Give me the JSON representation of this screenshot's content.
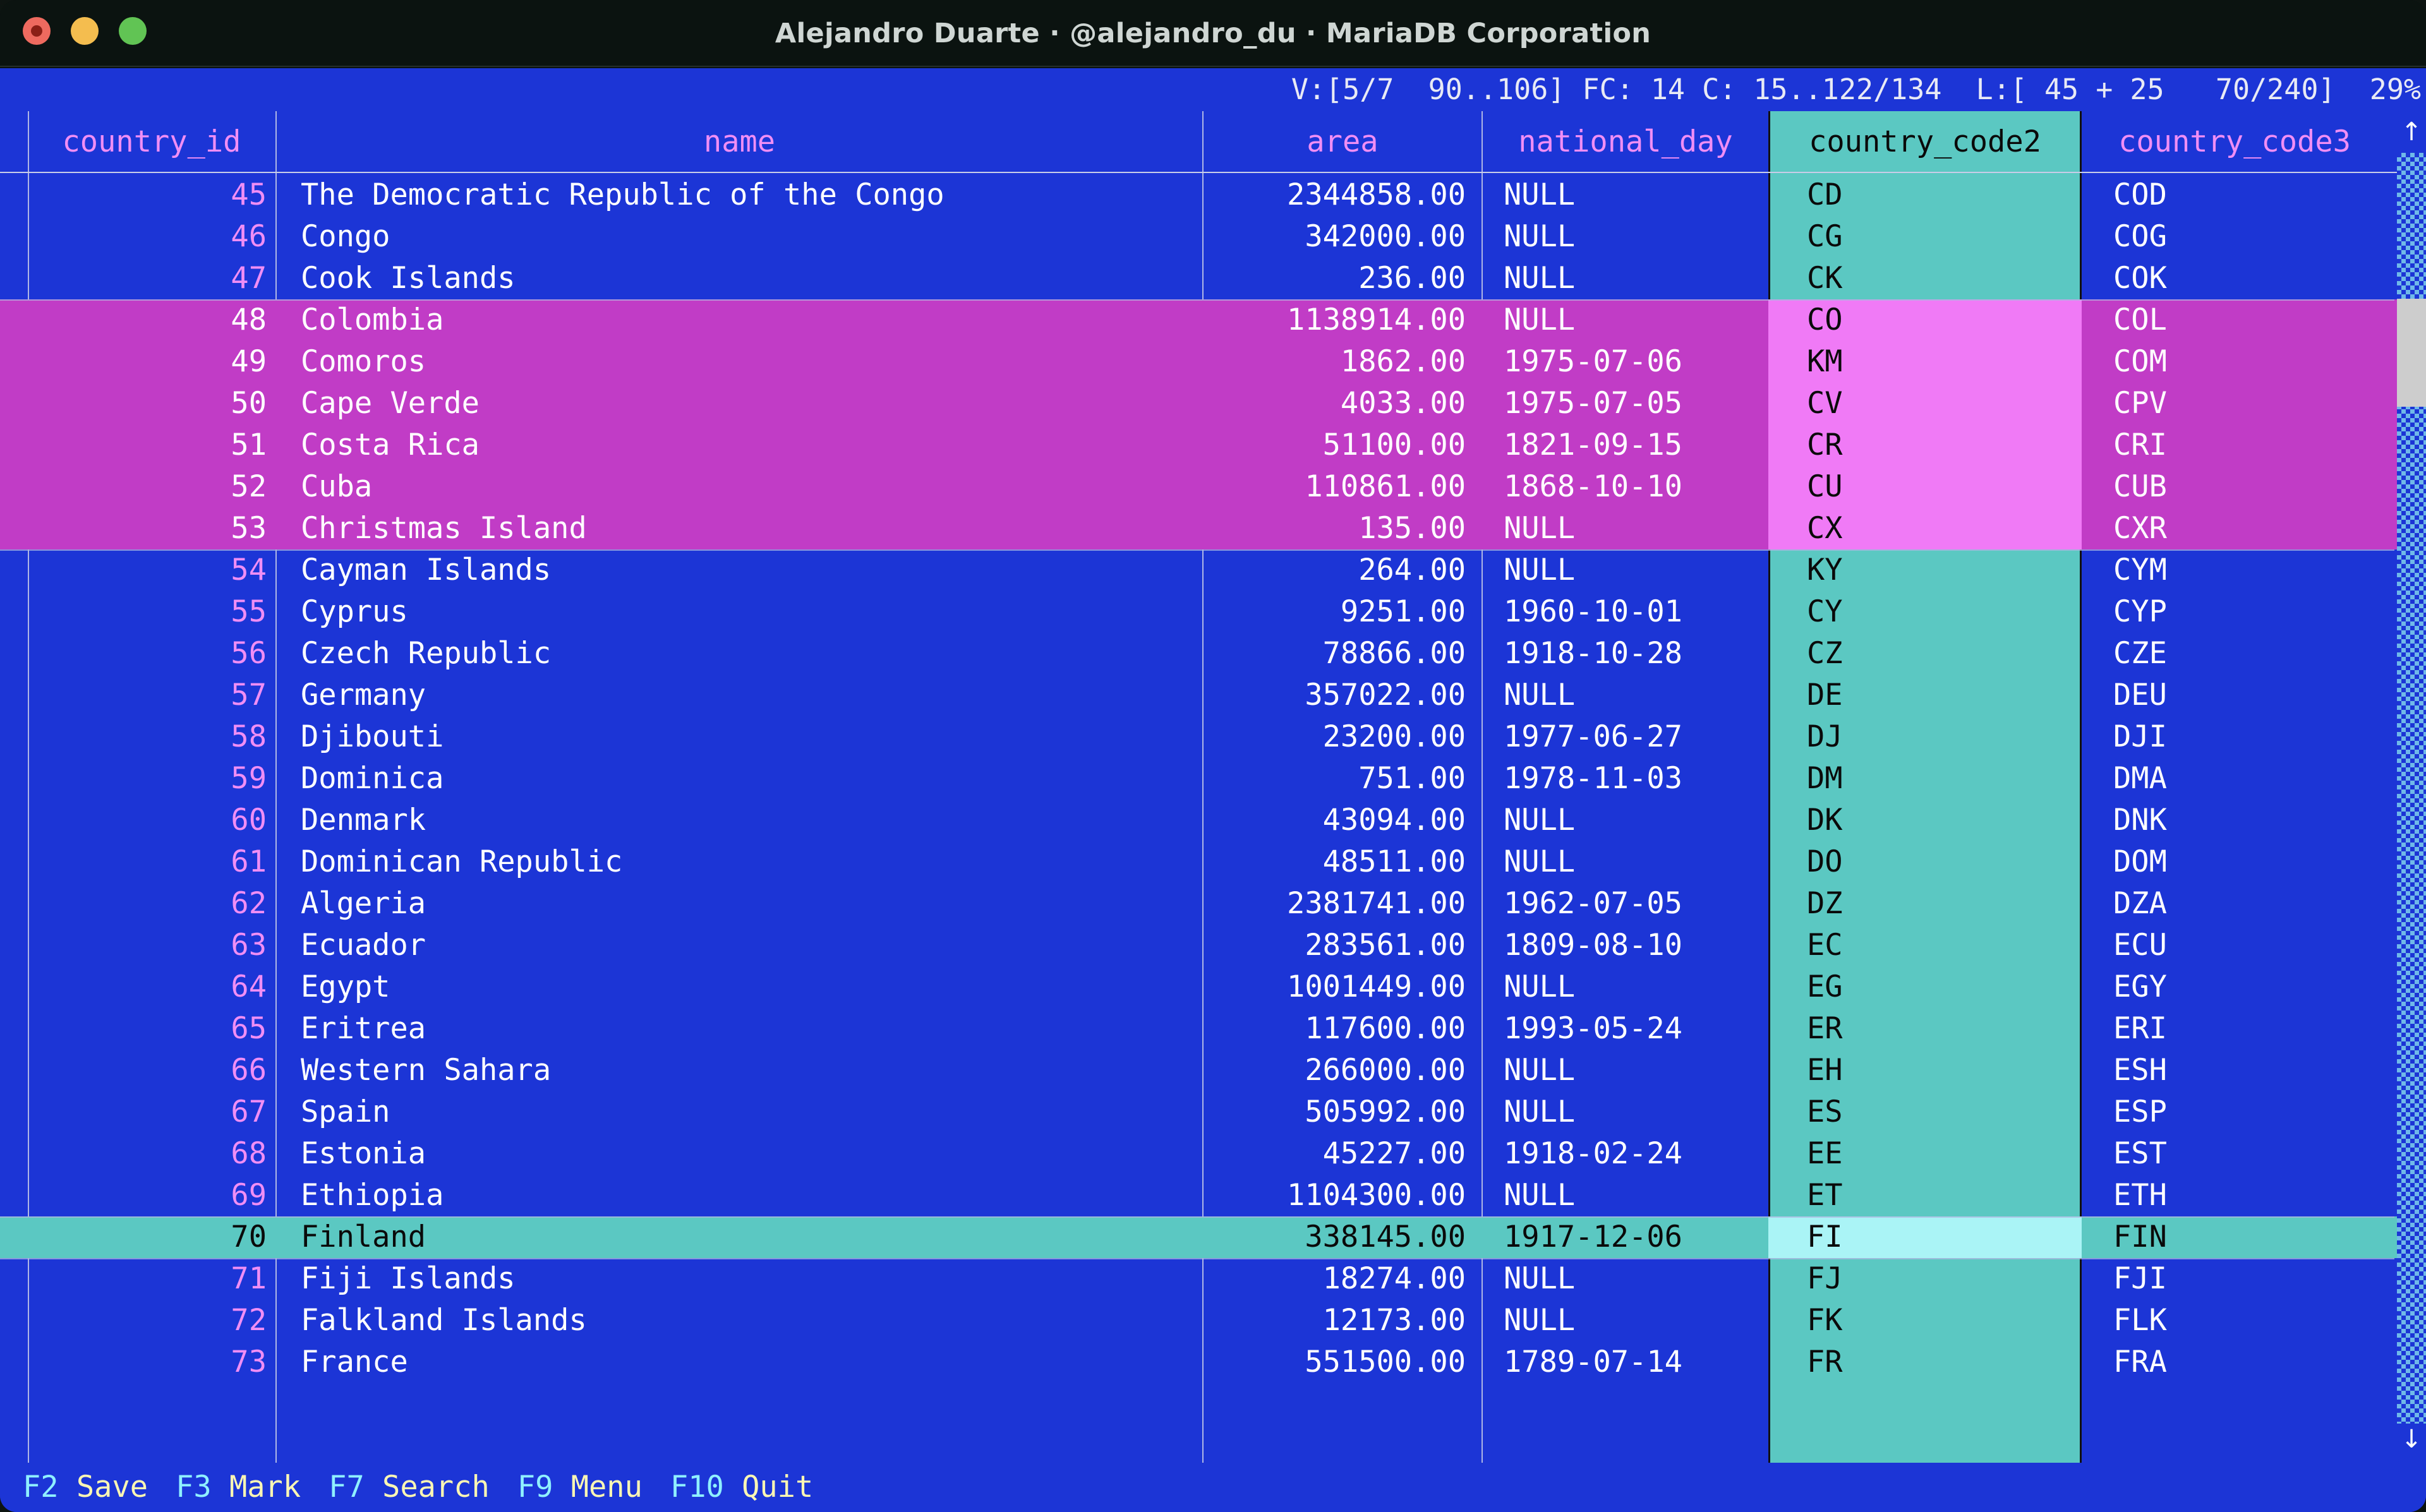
{
  "window": {
    "title": "Alejandro Duarte · @alejandro_du · MariaDB Corporation",
    "traffic_lights": [
      "close",
      "minimize",
      "zoom"
    ]
  },
  "statusline": {
    "text": "V:[5/7  90..106] FC: 14 C: 15..122/134  L:[ 45 + 25   70/240]  29%",
    "view": "V:[5/7  90..106]",
    "field_count": "FC: 14",
    "columns": "C: 15..122/134",
    "lines": "L:[ 45 + 25   70/240]",
    "percent": "29%"
  },
  "table": {
    "columns": [
      {
        "key": "country_id",
        "label": "country_id",
        "align": "right",
        "highlighted": false
      },
      {
        "key": "name",
        "label": "name",
        "align": "left",
        "highlighted": false
      },
      {
        "key": "area",
        "label": "area",
        "align": "right",
        "highlighted": false
      },
      {
        "key": "national_day",
        "label": "national_day",
        "align": "left",
        "highlighted": false
      },
      {
        "key": "country_code2",
        "label": "country_code2",
        "align": "left",
        "highlighted": true
      },
      {
        "key": "country_code3",
        "label": "country_code3",
        "align": "left",
        "highlighted": false
      }
    ],
    "rows": [
      {
        "country_id": "45",
        "name": "The Democratic Republic of the Congo",
        "area": "2344858.00",
        "national_day": "NULL",
        "country_code2": "CD",
        "country_code3": "COD",
        "state": "normal"
      },
      {
        "country_id": "46",
        "name": "Congo",
        "area": "342000.00",
        "national_day": "NULL",
        "country_code2": "CG",
        "country_code3": "COG",
        "state": "normal"
      },
      {
        "country_id": "47",
        "name": "Cook Islands",
        "area": "236.00",
        "national_day": "NULL",
        "country_code2": "CK",
        "country_code3": "COK",
        "state": "normal"
      },
      {
        "country_id": "48",
        "name": "Colombia",
        "area": "1138914.00",
        "national_day": "NULL",
        "country_code2": "CO",
        "country_code3": "COL",
        "state": "marked"
      },
      {
        "country_id": "49",
        "name": "Comoros",
        "area": "1862.00",
        "national_day": "1975-07-06",
        "country_code2": "KM",
        "country_code3": "COM",
        "state": "marked"
      },
      {
        "country_id": "50",
        "name": "Cape Verde",
        "area": "4033.00",
        "national_day": "1975-07-05",
        "country_code2": "CV",
        "country_code3": "CPV",
        "state": "marked"
      },
      {
        "country_id": "51",
        "name": "Costa Rica",
        "area": "51100.00",
        "national_day": "1821-09-15",
        "country_code2": "CR",
        "country_code3": "CRI",
        "state": "marked"
      },
      {
        "country_id": "52",
        "name": "Cuba",
        "area": "110861.00",
        "national_day": "1868-10-10",
        "country_code2": "CU",
        "country_code3": "CUB",
        "state": "marked"
      },
      {
        "country_id": "53",
        "name": "Christmas Island",
        "area": "135.00",
        "national_day": "NULL",
        "country_code2": "CX",
        "country_code3": "CXR",
        "state": "marked"
      },
      {
        "country_id": "54",
        "name": "Cayman Islands",
        "area": "264.00",
        "national_day": "NULL",
        "country_code2": "KY",
        "country_code3": "CYM",
        "state": "normal"
      },
      {
        "country_id": "55",
        "name": "Cyprus",
        "area": "9251.00",
        "national_day": "1960-10-01",
        "country_code2": "CY",
        "country_code3": "CYP",
        "state": "normal"
      },
      {
        "country_id": "56",
        "name": "Czech Republic",
        "area": "78866.00",
        "national_day": "1918-10-28",
        "country_code2": "CZ",
        "country_code3": "CZE",
        "state": "normal"
      },
      {
        "country_id": "57",
        "name": "Germany",
        "area": "357022.00",
        "national_day": "NULL",
        "country_code2": "DE",
        "country_code3": "DEU",
        "state": "normal"
      },
      {
        "country_id": "58",
        "name": "Djibouti",
        "area": "23200.00",
        "national_day": "1977-06-27",
        "country_code2": "DJ",
        "country_code3": "DJI",
        "state": "normal"
      },
      {
        "country_id": "59",
        "name": "Dominica",
        "area": "751.00",
        "national_day": "1978-11-03",
        "country_code2": "DM",
        "country_code3": "DMA",
        "state": "normal"
      },
      {
        "country_id": "60",
        "name": "Denmark",
        "area": "43094.00",
        "national_day": "NULL",
        "country_code2": "DK",
        "country_code3": "DNK",
        "state": "normal"
      },
      {
        "country_id": "61",
        "name": "Dominican Republic",
        "area": "48511.00",
        "national_day": "NULL",
        "country_code2": "DO",
        "country_code3": "DOM",
        "state": "normal"
      },
      {
        "country_id": "62",
        "name": "Algeria",
        "area": "2381741.00",
        "national_day": "1962-07-05",
        "country_code2": "DZ",
        "country_code3": "DZA",
        "state": "normal"
      },
      {
        "country_id": "63",
        "name": "Ecuador",
        "area": "283561.00",
        "national_day": "1809-08-10",
        "country_code2": "EC",
        "country_code3": "ECU",
        "state": "normal"
      },
      {
        "country_id": "64",
        "name": "Egypt",
        "area": "1001449.00",
        "national_day": "NULL",
        "country_code2": "EG",
        "country_code3": "EGY",
        "state": "normal"
      },
      {
        "country_id": "65",
        "name": "Eritrea",
        "area": "117600.00",
        "national_day": "1993-05-24",
        "country_code2": "ER",
        "country_code3": "ERI",
        "state": "normal"
      },
      {
        "country_id": "66",
        "name": "Western Sahara",
        "area": "266000.00",
        "national_day": "NULL",
        "country_code2": "EH",
        "country_code3": "ESH",
        "state": "normal"
      },
      {
        "country_id": "67",
        "name": "Spain",
        "area": "505992.00",
        "national_day": "NULL",
        "country_code2": "ES",
        "country_code3": "ESP",
        "state": "normal"
      },
      {
        "country_id": "68",
        "name": "Estonia",
        "area": "45227.00",
        "national_day": "1918-02-24",
        "country_code2": "EE",
        "country_code3": "EST",
        "state": "normal"
      },
      {
        "country_id": "69",
        "name": "Ethiopia",
        "area": "1104300.00",
        "national_day": "NULL",
        "country_code2": "ET",
        "country_code3": "ETH",
        "state": "normal"
      },
      {
        "country_id": "70",
        "name": "Finland",
        "area": "338145.00",
        "national_day": "1917-12-06",
        "country_code2": "FI",
        "country_code3": "FIN",
        "state": "cursor"
      },
      {
        "country_id": "71",
        "name": "Fiji Islands",
        "area": "18274.00",
        "national_day": "NULL",
        "country_code2": "FJ",
        "country_code3": "FJI",
        "state": "normal"
      },
      {
        "country_id": "72",
        "name": "Falkland Islands",
        "area": "12173.00",
        "national_day": "NULL",
        "country_code2": "FK",
        "country_code3": "FLK",
        "state": "normal"
      },
      {
        "country_id": "73",
        "name": "France",
        "area": "551500.00",
        "national_day": "1789-07-14",
        "country_code2": "FR",
        "country_code3": "FRA",
        "state": "normal"
      }
    ]
  },
  "scrollbar": {
    "up_arrow": "↑",
    "down_arrow": "↓",
    "thumb_top_pct": 11.5,
    "thumb_height_pct": 8.5
  },
  "function_keys": [
    {
      "key": "F2",
      "label": "Save"
    },
    {
      "key": "F3",
      "label": "Mark"
    },
    {
      "key": "F7",
      "label": "Search"
    },
    {
      "key": "F9",
      "label": "Menu"
    },
    {
      "key": "F10",
      "label": "Quit"
    }
  ],
  "colors": {
    "terminal_bg": "#1c35d6",
    "header_text": "#f08ef5",
    "marked_row": "#c13cc6",
    "marked_cell": "#f07af6",
    "cursor_row": "#5bc8c2",
    "cursor_cell": "#aaf4f6",
    "column_band": "#5bc8c2",
    "fn_key": "#8ff0ff",
    "fn_label": "#fbf6b4"
  }
}
